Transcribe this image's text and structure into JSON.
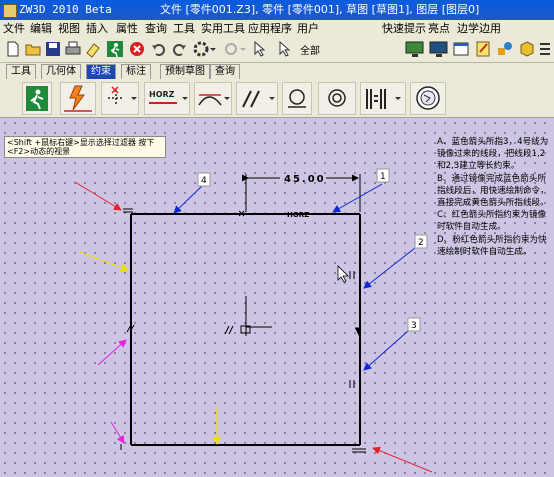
{
  "title": {
    "app": "ZW3D 2010 Beta",
    "file": "文件 [零件001.Z3], 零件 [零件001], 草图 [草图1], 图层 [图层0]"
  },
  "menu": {
    "items": [
      "文件",
      "编辑",
      "视图",
      "插入",
      "属性",
      "查询",
      "工具",
      "实用工具",
      "应用程序",
      "用户"
    ],
    "right_items": [
      "快速提示",
      "亮点",
      "边学边用"
    ]
  },
  "toolbar": {
    "filter_label": "全部"
  },
  "tabs": [
    {
      "label": "工具"
    },
    {
      "label": "几何体"
    },
    {
      "label": "约束"
    },
    {
      "label": "标注"
    },
    {
      "label": "预制草图"
    },
    {
      "label": "查询"
    }
  ],
  "constraint_toolbar": {
    "horz_label": "HORZ"
  },
  "canvas": {
    "hint": "<Shift +鼠标右键>显示选择过滤器 按下 <F2>动态的视景",
    "dimension": "45.00",
    "horz_tag": "HORZ",
    "callouts": [
      "1",
      "2",
      "3",
      "4"
    ],
    "notes": [
      "A、蓝色箭头所指3，4号线为镜像过来的线段，把线段1,2和2,3建立等长约束。",
      "B、通过镜像完成蓝色箭头所指线段后，用快速绘制命令，直接完成黄色箭头所指线段。",
      "C、红色箭头所指约束为镜像时软件自动生成。",
      "D、粉红色箭头所指约束为快速绘制时软件自动生成。"
    ]
  },
  "colors": {
    "title_blue": "#0a5be0",
    "canvas_bg": "#cdc5e3",
    "tab_active": "#1d47b7",
    "arrow_red": "#e8202a",
    "arrow_blue": "#1028d8",
    "arrow_yellow": "#f0e000",
    "arrow_pink": "#e820e0"
  }
}
